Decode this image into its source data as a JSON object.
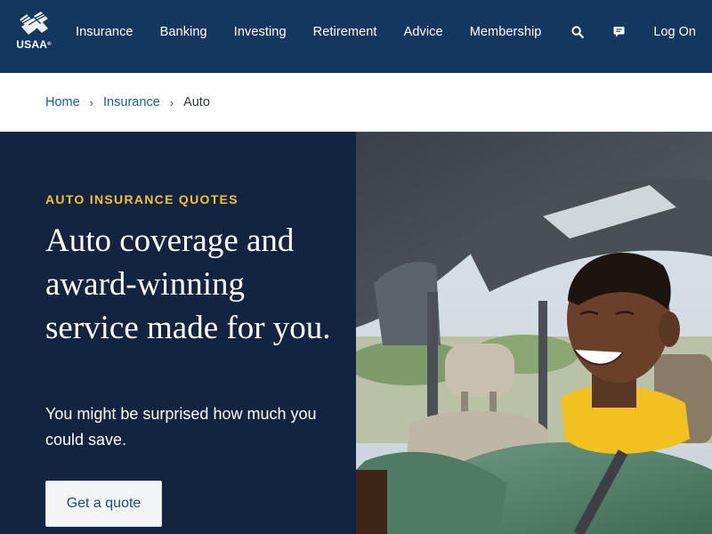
{
  "header": {
    "logo": {
      "text": "USAA",
      "mark": "®"
    },
    "nav": [
      "Insurance",
      "Banking",
      "Investing",
      "Retirement",
      "Advice",
      "Membership"
    ],
    "tools": {
      "search_icon": "search-icon",
      "chat_icon": "chat-icon"
    },
    "login_label": "Log On"
  },
  "breadcrumb": {
    "items": [
      "Home",
      "Insurance"
    ],
    "current": "Auto",
    "separator": "›"
  },
  "hero": {
    "eyebrow": "AUTO INSURANCE QUOTES",
    "headline": "Auto coverage and award-winning service made for you.",
    "subtext": "You might be surprised how much you could save.",
    "cta_label": "Get a quote",
    "image_description_icon": "smiling-driver-photo"
  },
  "colors": {
    "nav_bg": "#13375e",
    "hero_bg": "#12243f",
    "accent_gold": "#f4c136",
    "link_blue": "#1d5d8c"
  }
}
